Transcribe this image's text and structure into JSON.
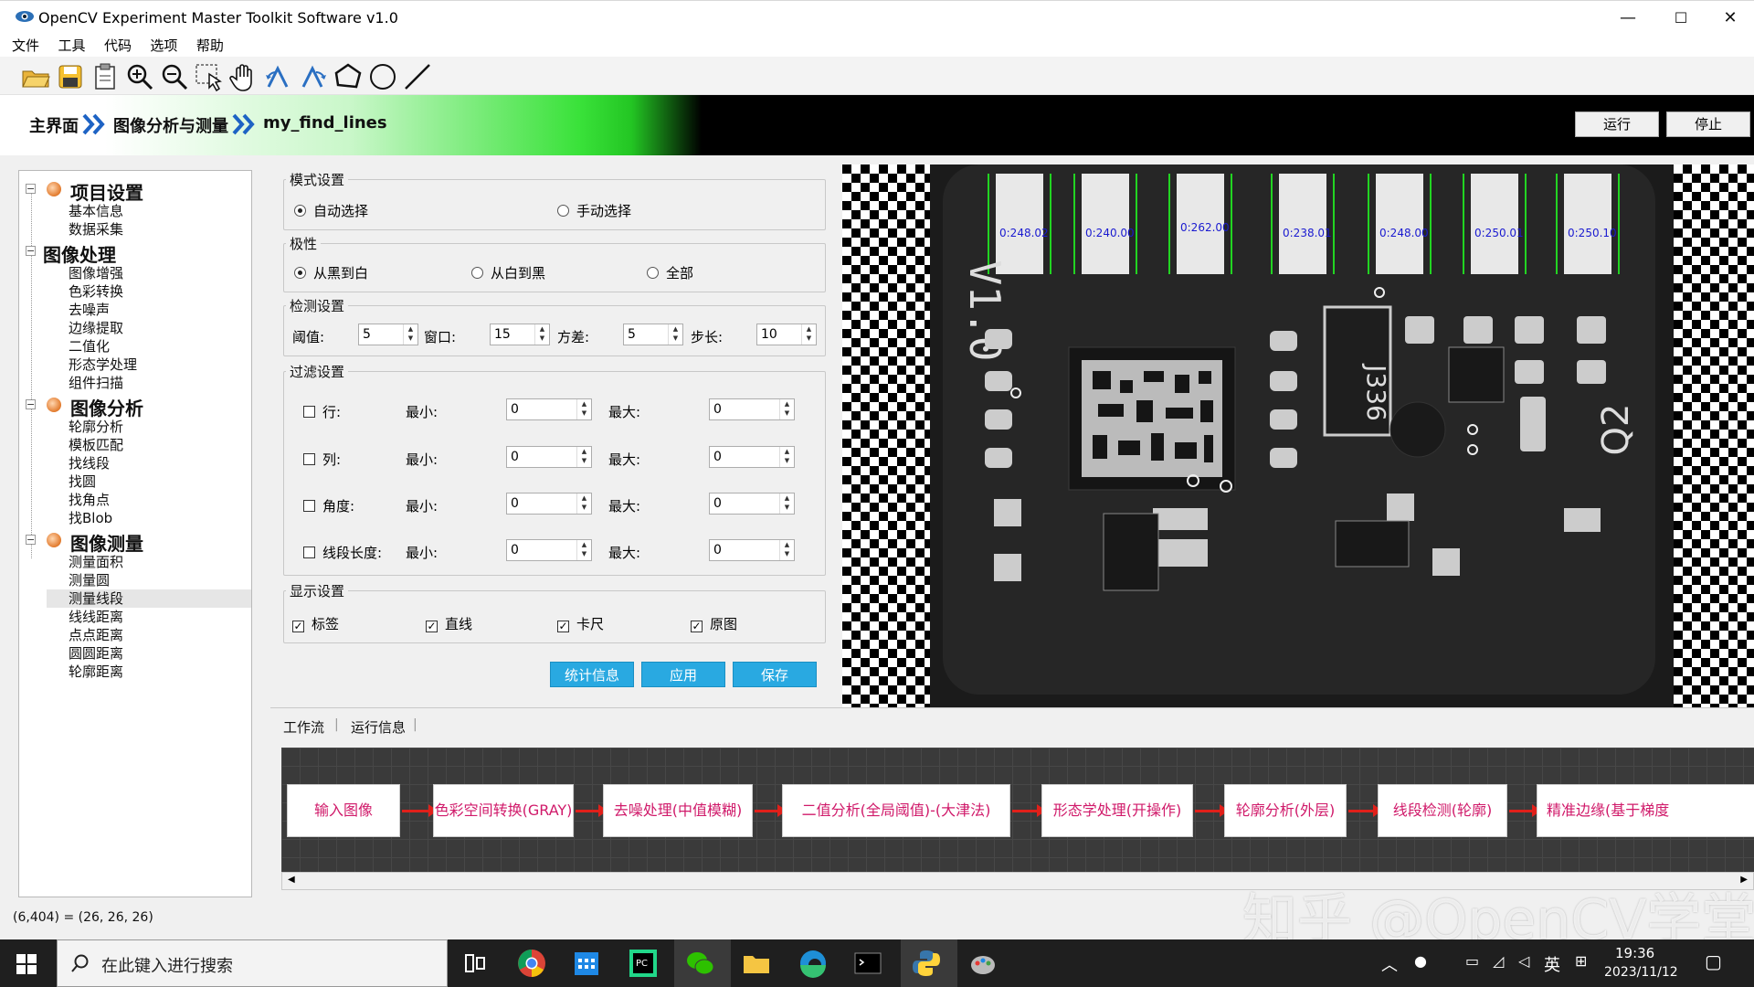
{
  "window": {
    "title": "OpenCV Experiment Master Toolkit Software v1.0",
    "min": "—",
    "max": "☐",
    "close": "✕"
  },
  "menu": [
    "文件",
    "工具",
    "代码",
    "选项",
    "帮助"
  ],
  "toolbar": [
    "open-folder-icon",
    "save-icon",
    "clipboard-icon",
    "zoom-in-icon",
    "zoom-out-icon",
    "select-pointer-icon",
    "pan-hand-icon",
    "rotate-left-icon",
    "rotate-right-icon",
    "polygon-icon",
    "circle-icon",
    "line-icon"
  ],
  "breadcrumb": [
    "主界面",
    "图像分析与测量",
    "my_find_lines"
  ],
  "actions": {
    "run": "运行",
    "stop": "停止"
  },
  "tree": [
    {
      "label": "项目设置",
      "children": [
        "基本信息",
        "数据采集"
      ]
    },
    {
      "label": "图像处理",
      "children": [
        "图像增强",
        "色彩转换",
        "去噪声",
        "边缘提取",
        "二值化",
        "形态学处理",
        "组件扫描"
      ]
    },
    {
      "label": "图像分析",
      "children": [
        "轮廓分析",
        "模板匹配",
        "找线段",
        "找圆",
        "找角点",
        "找Blob"
      ]
    },
    {
      "label": "图像测量",
      "children": [
        "测量面积",
        "测量圆",
        "测量线段",
        "线线距离",
        "点点距离",
        "圆圆距离",
        "轮廓距离"
      ]
    }
  ],
  "selected_item": "测量线段",
  "mode": {
    "title": "模式设置",
    "auto": "自动选择",
    "manual": "手动选择",
    "selected": "自动选择"
  },
  "polarity": {
    "title": "极性",
    "options": [
      "从黑到白",
      "从白到黑",
      "全部"
    ],
    "selected": "从黑到白"
  },
  "detect": {
    "title": "检测设置",
    "threshold_label": "阈值:",
    "threshold": "5",
    "window_label": "窗口:",
    "window": "15",
    "variance_label": "方差:",
    "variance": "5",
    "step_label": "步长:",
    "step": "10"
  },
  "filter": {
    "title": "过滤设置",
    "min_label": "最小:",
    "max_label": "最大:",
    "rows": [
      {
        "label": "行:",
        "checked": false,
        "min": "0",
        "max": "0"
      },
      {
        "label": "列:",
        "checked": false,
        "min": "0",
        "max": "0"
      },
      {
        "label": "角度:",
        "checked": false,
        "min": "0",
        "max": "0"
      },
      {
        "label": "线段长度:",
        "checked": false,
        "min": "0",
        "max": "0"
      }
    ]
  },
  "display": {
    "title": "显示设置",
    "options": [
      {
        "label": "标签",
        "checked": true
      },
      {
        "label": "直线",
        "checked": true
      },
      {
        "label": "卡尺",
        "checked": true
      },
      {
        "label": "原图",
        "checked": true
      }
    ]
  },
  "buttons": {
    "stats": "统计信息",
    "apply": "应用",
    "save": "保存"
  },
  "image_labels": [
    "0:248.02",
    "0:240.00",
    "0:262.00",
    "0:238.01",
    "0:248.00",
    "0:250.01",
    "0:250.10"
  ],
  "pcb_text": {
    "v": "V1.0",
    "chip": "J336",
    "q": "Q2"
  },
  "tabs": [
    "工作流",
    "运行信息"
  ],
  "workflow": [
    "输入图像",
    "色彩空间转换(GRAY)",
    "去噪处理(中值模糊)",
    "二值分析(全局阈值)-(大津法)",
    "形态学处理(开操作)",
    "轮廓分析(外层)",
    "线段检测(轮廓)",
    "精准边缘(基于梯度"
  ],
  "status": "(6,404) = (26, 26, 26)",
  "watermark": "知乎 @OpenCV学堂",
  "taskbar": {
    "search_placeholder": "在此键入进行搜索",
    "apps": [
      "task-view-icon",
      "chrome-icon",
      "calendar-icon",
      "pycharm-icon",
      "wechat-icon",
      "file-explorer-icon",
      "edge-icon",
      "terminal-icon",
      "python-icon",
      "paint-icon"
    ],
    "ime": "英",
    "time": "19:36",
    "date": "2023/11/12"
  },
  "colors": {
    "accent": "#29a9e1",
    "node_text": "#d01a6a",
    "arrow": "#e0201a"
  }
}
